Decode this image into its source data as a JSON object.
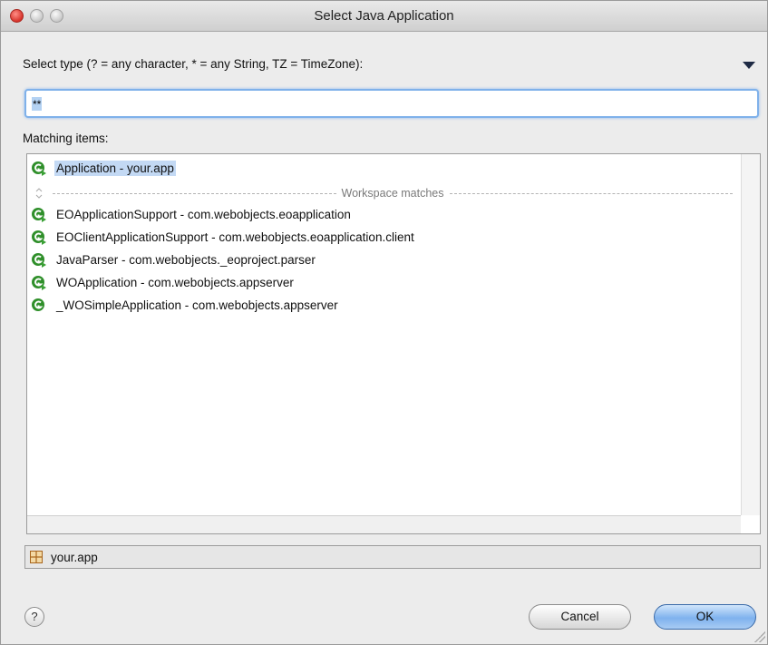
{
  "window": {
    "title": "Select Java Application"
  },
  "filter": {
    "label": "Select type (? = any character, * = any String, TZ = TimeZone):",
    "value": "**"
  },
  "matching_label": "Matching items:",
  "list": {
    "top_item": "Application - your.app",
    "separator_text": "Workspace matches",
    "items": [
      "EOApplicationSupport - com.webobjects.eoapplication",
      "EOClientApplicationSupport - com.webobjects.eoapplication.client",
      "JavaParser - com.webobjects._eoproject.parser",
      "WOApplication - com.webobjects.appserver",
      "_WOSimpleApplication - com.webobjects.appserver"
    ]
  },
  "status": {
    "package": "your.app"
  },
  "buttons": {
    "help": "?",
    "cancel": "Cancel",
    "ok": "OK"
  },
  "icons": {
    "app": "java-application-icon",
    "package": "package-icon",
    "separator": "separator-chevron-icon",
    "menu": "view-menu-icon"
  },
  "colors": {
    "accent": "#7fb1ea",
    "selection": "#c3d9f4",
    "app_icon": "#2f8f2a"
  }
}
